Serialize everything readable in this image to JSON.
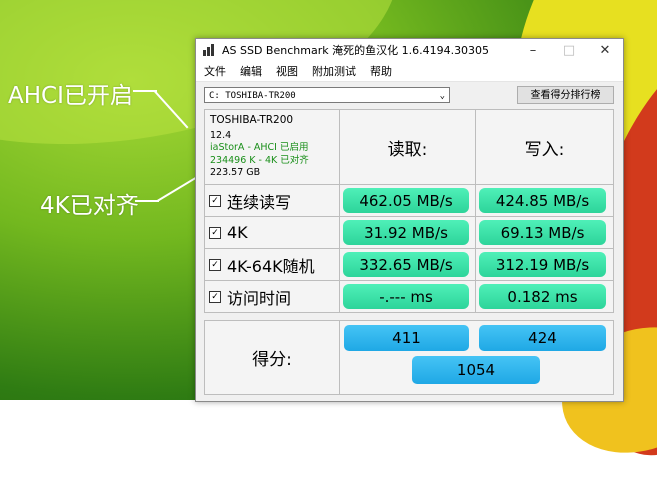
{
  "annotations": {
    "ahci": "AHCI已开启",
    "align4k": "4K已对齐"
  },
  "window": {
    "title": "AS SSD Benchmark 淹死的鱼汉化 1.6.4194.30305"
  },
  "menu": [
    "文件",
    "编辑",
    "视图",
    "附加测试",
    "帮助"
  ],
  "drive_select": {
    "value": "C: TOSHIBA-TR200"
  },
  "rank_button": "查看得分排行榜",
  "drive_info": {
    "model": "TOSHIBA-TR200",
    "firmware": "12.4",
    "driver": "iaStorA - AHCI 已启用",
    "alignment": "234496 K - 4K 已对齐",
    "size": "223.57 GB"
  },
  "headers": {
    "read": "读取:",
    "write": "写入:"
  },
  "rows": [
    {
      "label": "连续读写",
      "read": "462.05 MB/s",
      "write": "424.85 MB/s"
    },
    {
      "label": "4K",
      "read": "31.92 MB/s",
      "write": "69.13 MB/s"
    },
    {
      "label": "4K-64K随机",
      "read": "332.65 MB/s",
      "write": "312.19 MB/s"
    },
    {
      "label": "访问时间",
      "read": "-.--- ms",
      "write": "0.182 ms"
    }
  ],
  "score": {
    "label": "得分:",
    "read": "411",
    "write": "424",
    "total": "1054"
  },
  "colors": {
    "result_green": "#2dd49a",
    "score_blue": "#1fa8e5",
    "driver_text_green": "#1a8f1a"
  }
}
